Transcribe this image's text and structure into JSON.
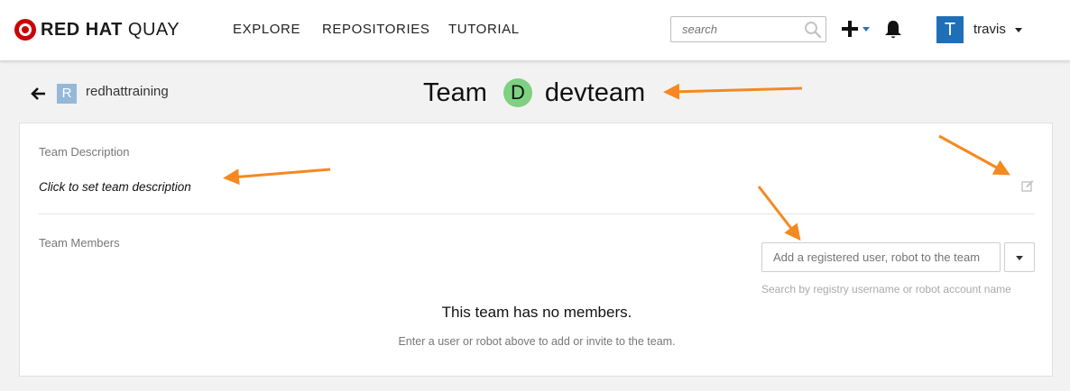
{
  "brand": {
    "logo_bold": "RED HAT",
    "logo_light": "QUAY",
    "color": "#cc0000"
  },
  "nav": {
    "explore": "EXPLORE",
    "repositories": "REPOSITORIES",
    "tutorial": "TUTORIAL"
  },
  "search": {
    "placeholder": "search"
  },
  "user": {
    "avatar_letter": "T",
    "name": "travis",
    "avatar_color": "#1f6fb7"
  },
  "org": {
    "avatar_letter": "R",
    "name": "redhattraining"
  },
  "team": {
    "prefix": "Team",
    "badge_letter": "D",
    "name": "devteam",
    "badge_color": "#7dd181"
  },
  "description": {
    "label": "Team Description",
    "value": "Click to set team description"
  },
  "members": {
    "label": "Team Members",
    "add_placeholder": "Add a registered user, robot to the team",
    "help": "Search by registry username or robot account name",
    "empty_title": "This team has no members.",
    "empty_subtitle": "Enter a user or robot above to add or invite to the team."
  },
  "annotation_color": "#f5891f"
}
